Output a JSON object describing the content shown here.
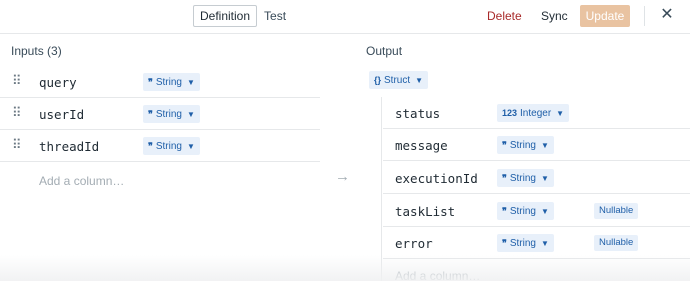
{
  "header": {
    "tabs": [
      {
        "label": "Definition",
        "active": true
      },
      {
        "label": "Test",
        "active": false
      }
    ],
    "delete_label": "Delete",
    "sync_label": "Sync",
    "update_label": "Update",
    "close_icon": "✕"
  },
  "inputs": {
    "title": "Inputs (3)",
    "drag_icon": "⠿",
    "fields": [
      {
        "name": "query",
        "type": "String",
        "type_icon": "❞"
      },
      {
        "name": "userId",
        "type": "String",
        "type_icon": "❞"
      },
      {
        "name": "threadId",
        "type": "String",
        "type_icon": "❞"
      }
    ],
    "add_column": "Add a column…"
  },
  "arrow_icon": "→",
  "output": {
    "title": "Output",
    "struct": {
      "type": "Struct",
      "type_icon": "{}"
    },
    "fields": [
      {
        "name": "status",
        "type": "Integer",
        "type_icon": "123",
        "nullable": ""
      },
      {
        "name": "message",
        "type": "String",
        "type_icon": "❞",
        "nullable": ""
      },
      {
        "name": "executionId",
        "type": "String",
        "type_icon": "❞",
        "nullable": ""
      },
      {
        "name": "taskList",
        "type": "String",
        "type_icon": "❞",
        "nullable": "Nullable"
      },
      {
        "name": "error",
        "type": "String",
        "type_icon": "❞",
        "nullable": "Nullable"
      }
    ],
    "add_column": "Add a column…"
  },
  "colors": {
    "accent": "#1f5fa8",
    "delete": "#a82a2a",
    "update_disabled": "#e9c3a1"
  }
}
